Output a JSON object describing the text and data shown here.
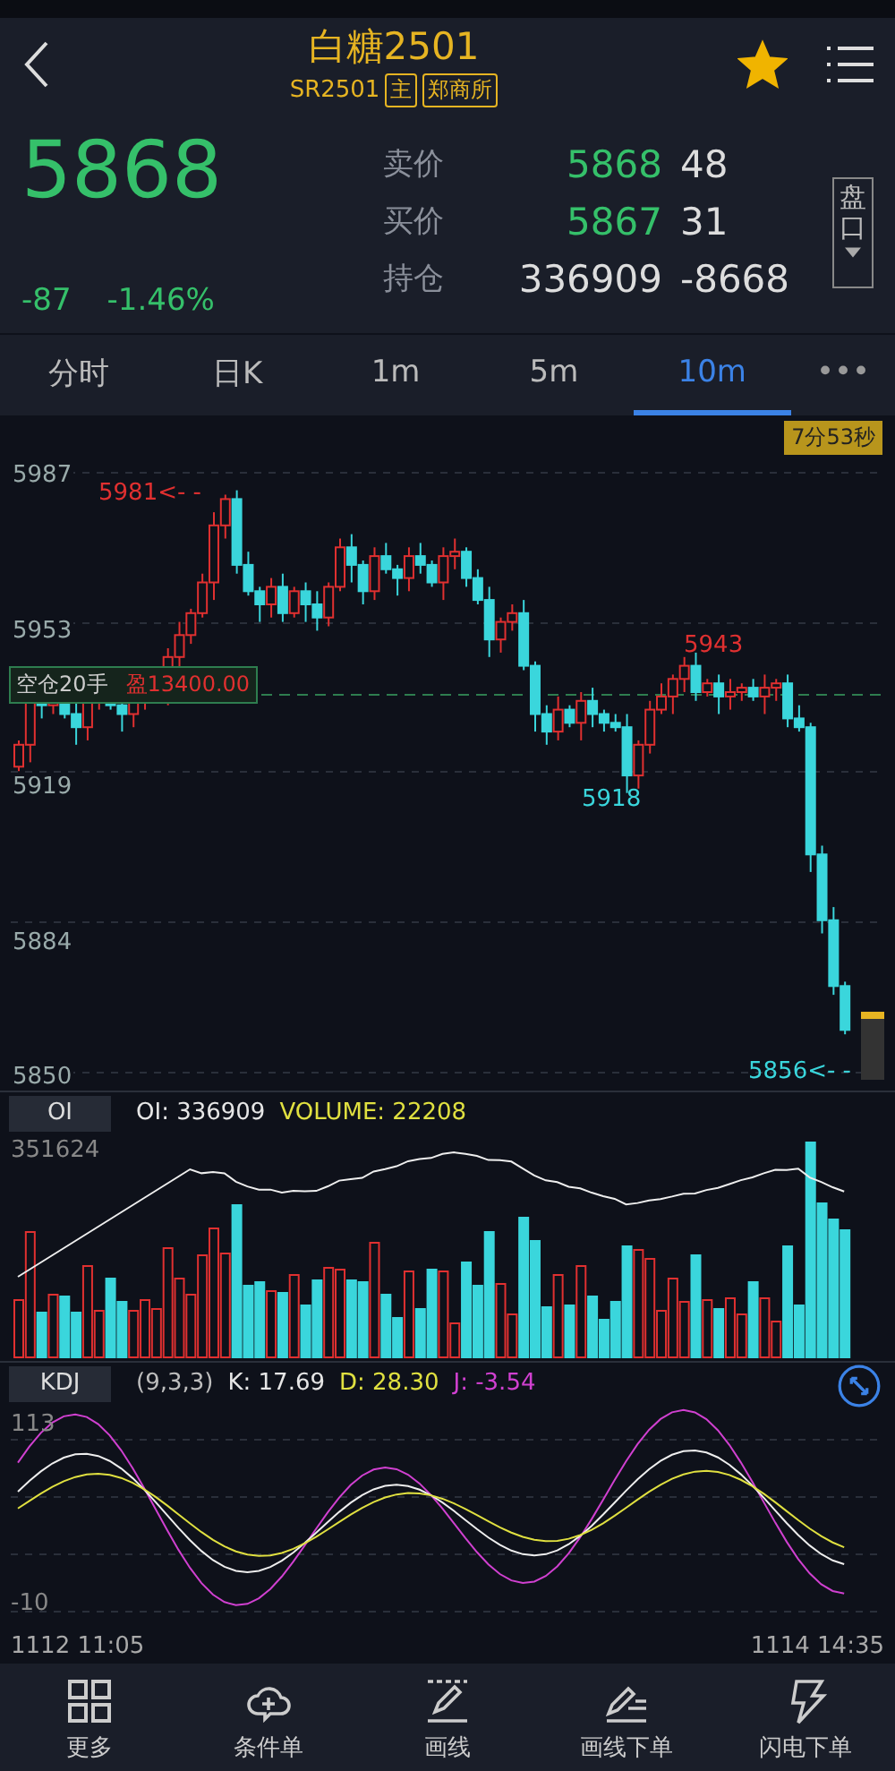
{
  "header": {
    "title": "白糖2501",
    "code": "SR2501",
    "tags": [
      "主",
      "郑商所"
    ],
    "favorite": true
  },
  "quote": {
    "last": "5868",
    "change": "-87",
    "percent": "-1.46%",
    "book": [
      {
        "label": "卖价",
        "price": "5868",
        "qty": "48",
        "kind": "quote"
      },
      {
        "label": "买价",
        "price": "5867",
        "qty": "31",
        "kind": "quote"
      },
      {
        "label": "持仓",
        "price": "336909",
        "qty": "-8668",
        "kind": "open_interest"
      }
    ],
    "side_button": "盘口"
  },
  "tabs": [
    {
      "label": "分时",
      "selected": false
    },
    {
      "label": "日K",
      "selected": false
    },
    {
      "label": "1m",
      "selected": false
    },
    {
      "label": "5m",
      "selected": false
    },
    {
      "label": "10m",
      "selected": true
    }
  ],
  "more_tab": "•••",
  "main_chart": {
    "timer": "7分53秒",
    "y_labels": [
      "5987",
      "5953",
      "5919",
      "5884",
      "5850"
    ],
    "markers": [
      {
        "text": "5981<- -",
        "kind": "high"
      },
      {
        "text": "5943",
        "kind": "high"
      },
      {
        "text": "5918",
        "kind": "low"
      },
      {
        "text": "5856<- -",
        "kind": "low"
      }
    ],
    "position": {
      "label": "空仓20手",
      "profit": "盈13400.00"
    }
  },
  "oi_panel": {
    "tab": "OI",
    "stats": [
      {
        "text": "OI: 336909",
        "color": "#e6e6e6"
      },
      {
        "text": "VOLUME: 22208",
        "color": "#e0e040"
      }
    ],
    "y_label": "351624"
  },
  "kdj_panel": {
    "tab": "KDJ",
    "stats": [
      {
        "text": "(9,3,3)",
        "color": "#bdbdbd"
      },
      {
        "text": "K: 17.69",
        "color": "#e6e6e6"
      },
      {
        "text": "D: 28.30",
        "color": "#e0e040"
      },
      {
        "text": "J: -3.54",
        "color": "#d040d0"
      }
    ],
    "y_labels": [
      "113",
      "-10"
    ]
  },
  "time_axis": [
    "1112 11:05",
    "1114 14:35"
  ],
  "nav": [
    {
      "label": "更多"
    },
    {
      "label": "条件单"
    },
    {
      "label": "画线"
    },
    {
      "label": "画线下单"
    },
    {
      "label": "闪电下单"
    }
  ]
}
